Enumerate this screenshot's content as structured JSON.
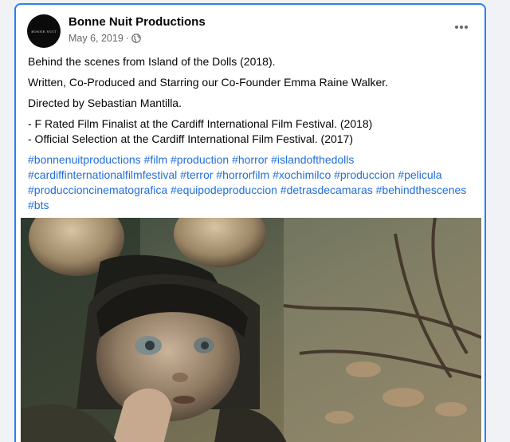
{
  "post": {
    "author": "Bonne Nuit Productions",
    "avatar_text": "BONNE NUIT",
    "date": "May 6, 2019",
    "separator": "·",
    "privacy_icon": "globe-icon",
    "more_icon": "more-horizontal-icon",
    "paragraphs": [
      "Behind the scenes from Island of the Dolls (2018).",
      "Written, Co-Produced and Starring our Co-Founder Emma Raine Walker.",
      "Directed by Sebastian Mantilla."
    ],
    "festival_lines": [
      "- F Rated Film Finalist at the Cardiff International Film Festival. (2018)",
      "- Official Selection at the Cardiff International Film Festival. (2017)"
    ],
    "hashtags": [
      "#bonnenuitproductions",
      "#film",
      "#production",
      "#horror",
      "#islandofthedolls",
      "#cardiffinternationalfilmfestival",
      "#terror",
      "#horrorfilm",
      "#xochimilco",
      "#produccion",
      "#pelicula",
      "#produccioncinematografica",
      "#equipodeproduccion",
      "#detrasdecamaras",
      "#behindthescenes",
      "#bts"
    ],
    "media_icon": "doll-photo"
  },
  "colors": {
    "card_border": "#2d7ff0",
    "hashtag": "#216fdb",
    "meta_text": "#65676b",
    "page_bg": "#f0f2f5"
  }
}
